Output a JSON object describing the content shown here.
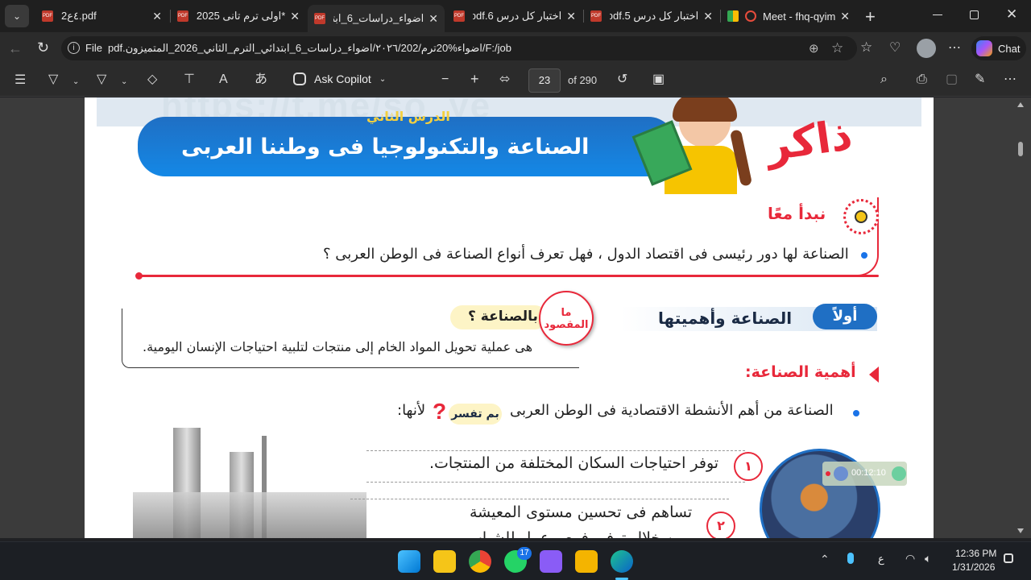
{
  "tabs": [
    {
      "title": "pdf.٤ع2",
      "active": false
    },
    {
      "title": "*اولى ترم تانى 2025.pdf",
      "active": false
    },
    {
      "title": "اضواء_دراسات_6_ابتدائ",
      "active": true
    },
    {
      "title": "اختبار كل درس pdf.6",
      "active": false
    },
    {
      "title": "اختبار كل درس pdf.5",
      "active": false
    },
    {
      "title": "Meet - fhq-qyim",
      "active": false
    }
  ],
  "address": {
    "scheme_label": "File",
    "url": "F:/job/اضواء%20ترم/٢٠٢٦/202/اضواء_دراسات_6_ابتدائي_الترم_الثاني_2026_المتميزون.pdf"
  },
  "browser": {
    "chat_label": "Chat"
  },
  "pdf_toolbar": {
    "copilot_label": "Ask Copilot",
    "page_current": "23",
    "page_total": "of 290"
  },
  "page": {
    "watermark": "https://t.me/so_ye",
    "lesson_label": "الدرس الثاني",
    "lesson_title": "الصناعة والتكنولوجيا فى وطننا العربى",
    "brand": "ذاكر",
    "start_heading": "نبدأ معًا",
    "intro_bullet": "الصناعة لها دور رئيسى فى اقتصاد الدول ، فهل تعرف أنواع الصناعة فى الوطن العربى ؟",
    "first_label": "أولاً",
    "section_title": "الصناعة وأهميتها",
    "meaning_badge": "ما المقصود",
    "meaning_question": "بالصناعة ؟",
    "meaning_answer": "هى عملية تحويل المواد الخام إلى منتجات لتلبية احتياجات الإنسان اليومية.",
    "importance_heading": "أهمية الصناعة:",
    "importance_bullet_start": "الصناعة من أهم الأنشطة الاقتصادية فى الوطن العربى",
    "why_badge": "بم تفسر",
    "importance_bullet_end": "لأنها:",
    "points": [
      {
        "num": "١",
        "text": "توفر احتياجات السكان المختلفة من المنتجات."
      },
      {
        "num": "٢",
        "text": "تساهم فى تحسين مستوى المعيشة"
      }
    ],
    "point2_cont": "من خلال توفير فرص عمل للشباب.",
    "overlay_timer": "00:12:10"
  },
  "taskbar": {
    "whatsapp_badge": "17",
    "lang": "ع",
    "time": "12:36 PM",
    "date": "1/31/2026"
  }
}
